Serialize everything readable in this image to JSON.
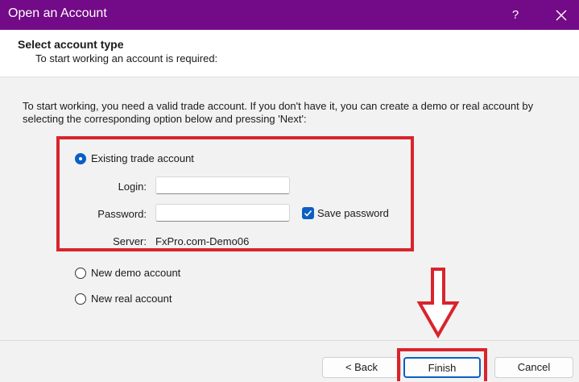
{
  "window": {
    "title": "Open an Account",
    "help_label": "?",
    "close_icon": "close-icon"
  },
  "header": {
    "heading": "Select account type",
    "subheading": "To start working an account is required:"
  },
  "main": {
    "intro": "To start working, you need a valid trade account. If you don't have it, you can create a demo or real account by selecting the corresponding option below and pressing 'Next':",
    "options": {
      "existing": {
        "label": "Existing trade account",
        "selected": true
      },
      "demo": {
        "label": "New demo account",
        "selected": false
      },
      "real": {
        "label": "New real account",
        "selected": false
      }
    },
    "login": {
      "label": "Login:",
      "value": ""
    },
    "password": {
      "label": "Password:",
      "value": ""
    },
    "save_password": {
      "label": "Save password",
      "checked": true
    },
    "server": {
      "label": "Server:",
      "value": "FxPro.com-Demo06"
    }
  },
  "footer": {
    "back_label": "< Back",
    "finish_label": "Finish",
    "cancel_label": "Cancel"
  },
  "colors": {
    "titlebar": "#730a87",
    "accent": "#0b5fc4",
    "annotation": "#d9242c"
  }
}
